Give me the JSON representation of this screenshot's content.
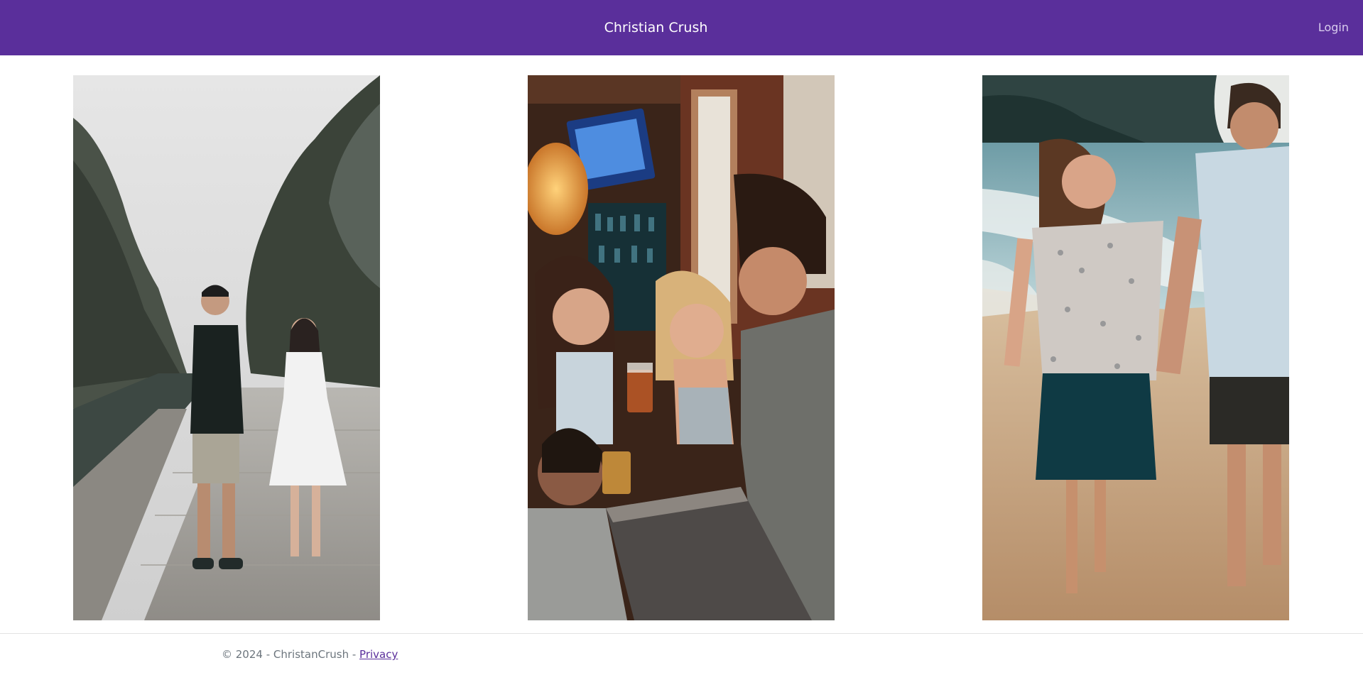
{
  "navbar": {
    "brand": "Christian Crush",
    "login_label": "Login"
  },
  "gallery": [
    {
      "subject": "couple holding hands on stone river path"
    },
    {
      "subject": "friends laughing and drinking at a bar"
    },
    {
      "subject": "couple holding hands walking on the beach"
    }
  ],
  "footer": {
    "copyright": "© 2024 - ChristanCrush - ",
    "privacy_label": "Privacy"
  },
  "colors": {
    "navbar_bg": "#5a2f9b",
    "link": "#5a2f9b",
    "footer_text": "#6c757d"
  }
}
